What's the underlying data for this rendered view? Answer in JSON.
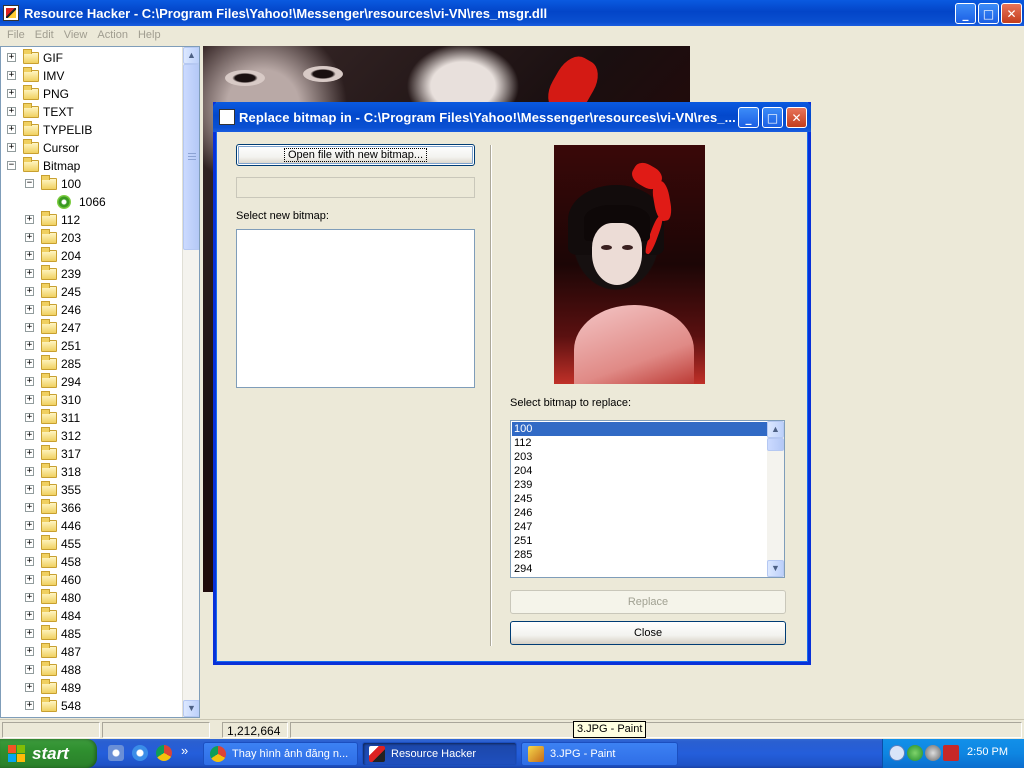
{
  "main_window": {
    "title": "Resource Hacker  -  C:\\Program Files\\Yahoo!\\Messenger\\resources\\vi-VN\\res_msgr.dll",
    "controls": {
      "minimize": "_",
      "maximize": "□",
      "close": "✕"
    }
  },
  "menu": [
    "File",
    "Edit",
    "View",
    "Action",
    "Help"
  ],
  "tree": {
    "top_items": [
      "GIF",
      "IMV",
      "PNG",
      "TEXT",
      "TYPELIB",
      "Cursor",
      "Bitmap"
    ],
    "open_folder": "100",
    "leaf": "1066",
    "bitmap_children": [
      "112",
      "203",
      "204",
      "239",
      "245",
      "246",
      "247",
      "251",
      "285",
      "294",
      "310",
      "311",
      "312",
      "317",
      "318",
      "355",
      "366",
      "446",
      "455",
      "458",
      "460",
      "480",
      "484",
      "485",
      "487",
      "488",
      "489",
      "548"
    ],
    "expander_plus": "+",
    "expander_minus": "−"
  },
  "status": {
    "size": "1,212,664",
    "tooltip": "3.JPG - Paint"
  },
  "dialog": {
    "title": "Replace bitmap in - C:\\Program Files\\Yahoo!\\Messenger\\resources\\vi-VN\\res_...",
    "open_button": "Open file with new bitmap...",
    "select_new_label": "Select new bitmap:",
    "select_replace_label": "Select bitmap to replace:",
    "replace_items": [
      "100",
      "112",
      "203",
      "204",
      "239",
      "245",
      "246",
      "247",
      "251",
      "285",
      "294"
    ],
    "selected_item": "100",
    "replace_button": "Replace",
    "close_button": "Close"
  },
  "taskbar": {
    "start_label": "start",
    "chevron": "»",
    "tasks": [
      {
        "label": "Thay hình ảnh đăng n...",
        "icon": "chrome-icon",
        "active": false
      },
      {
        "label": "Resource Hacker",
        "icon": "resource-hacker-icon",
        "active": true
      },
      {
        "label": "3.JPG - Paint",
        "icon": "paint-icon",
        "active": false
      }
    ],
    "clock": "2:50 PM"
  },
  "colors": {
    "title_blue": "#0348cc",
    "selection_blue": "#316ac5",
    "taskbar_blue": "#245edb",
    "start_green": "#2f8f2f"
  }
}
